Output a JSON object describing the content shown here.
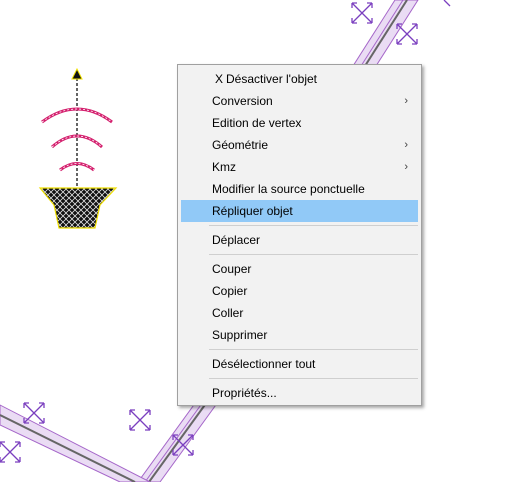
{
  "context_menu": {
    "items": [
      {
        "label": "Désactiver l'objet",
        "icon": "x-icon"
      },
      {
        "label": "Conversion",
        "submenu": true
      },
      {
        "label": "Edition de vertex"
      },
      {
        "label": "Géométrie",
        "submenu": true
      },
      {
        "label": "Kmz",
        "submenu": true
      },
      {
        "label": "Modifier la source ponctuelle"
      },
      {
        "label": "Répliquer objet",
        "highlighted": true
      },
      {
        "label": "Déplacer"
      },
      {
        "label": "Couper"
      },
      {
        "label": "Copier"
      },
      {
        "label": "Coller"
      },
      {
        "label": "Supprimer"
      },
      {
        "label": "Désélectionner tout"
      },
      {
        "label": "Propriétés..."
      }
    ],
    "x_glyph": "X",
    "submenu_glyph": "›",
    "highlight_color": "#91c9f7"
  },
  "map": {
    "road_fill_color": "#eadcf4",
    "road_edge_color": "#a566c9",
    "road_center_color": "#666666",
    "handle_color": "#7b3fbf",
    "wave_color": "#d4206e",
    "mast_color": "#f0e000",
    "icons": [
      "antenna-symbol-icon",
      "resize-handle-icon"
    ]
  }
}
